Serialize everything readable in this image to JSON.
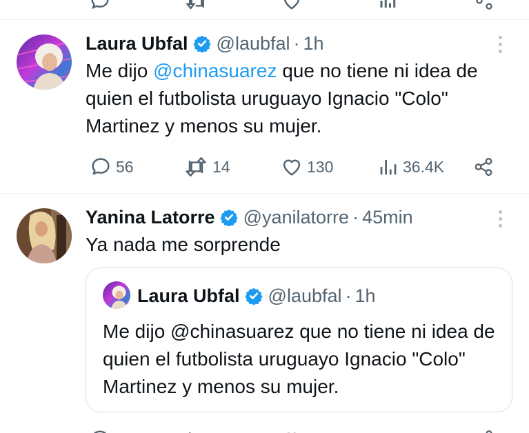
{
  "tweets": [
    {
      "author_name": "Laura Ubfal",
      "handle": "@laubfal",
      "separator": "·",
      "time": "1h",
      "text_parts": [
        {
          "text": "Me dijo ",
          "type": "text"
        },
        {
          "text": "@chinasuarez",
          "type": "mention"
        },
        {
          "text": " que no tiene ni idea de quien el futbolista uruguayo Ignacio \"Colo\" Martinez y menos su mujer.",
          "type": "text"
        }
      ],
      "stats": {
        "replies": "56",
        "retweets": "14",
        "likes": "130",
        "views": "36.4K"
      },
      "icons": [
        "verified-badge-icon",
        "more-options-icon",
        "reply-icon",
        "retweet-icon",
        "like-icon",
        "views-icon",
        "share-icon"
      ]
    },
    {
      "author_name": "Yanina Latorre",
      "handle": "@yanilatorre",
      "separator": "·",
      "time": "45min",
      "text": "Ya nada me sorprende",
      "quoted": {
        "author_name": "Laura Ubfal",
        "handle": "@laubfal",
        "separator": "·",
        "time": "1h",
        "text": "Me dijo @chinasuarez que no tiene ni idea de quien el futbolista uruguayo Ignacio \"Colo\" Martinez y menos su mujer."
      }
    }
  ],
  "colors": {
    "text": "#0f1419",
    "secondary": "#536471",
    "accent": "#1d9bf0",
    "divider": "#eff3f4",
    "verified": "#1d9bf0"
  }
}
